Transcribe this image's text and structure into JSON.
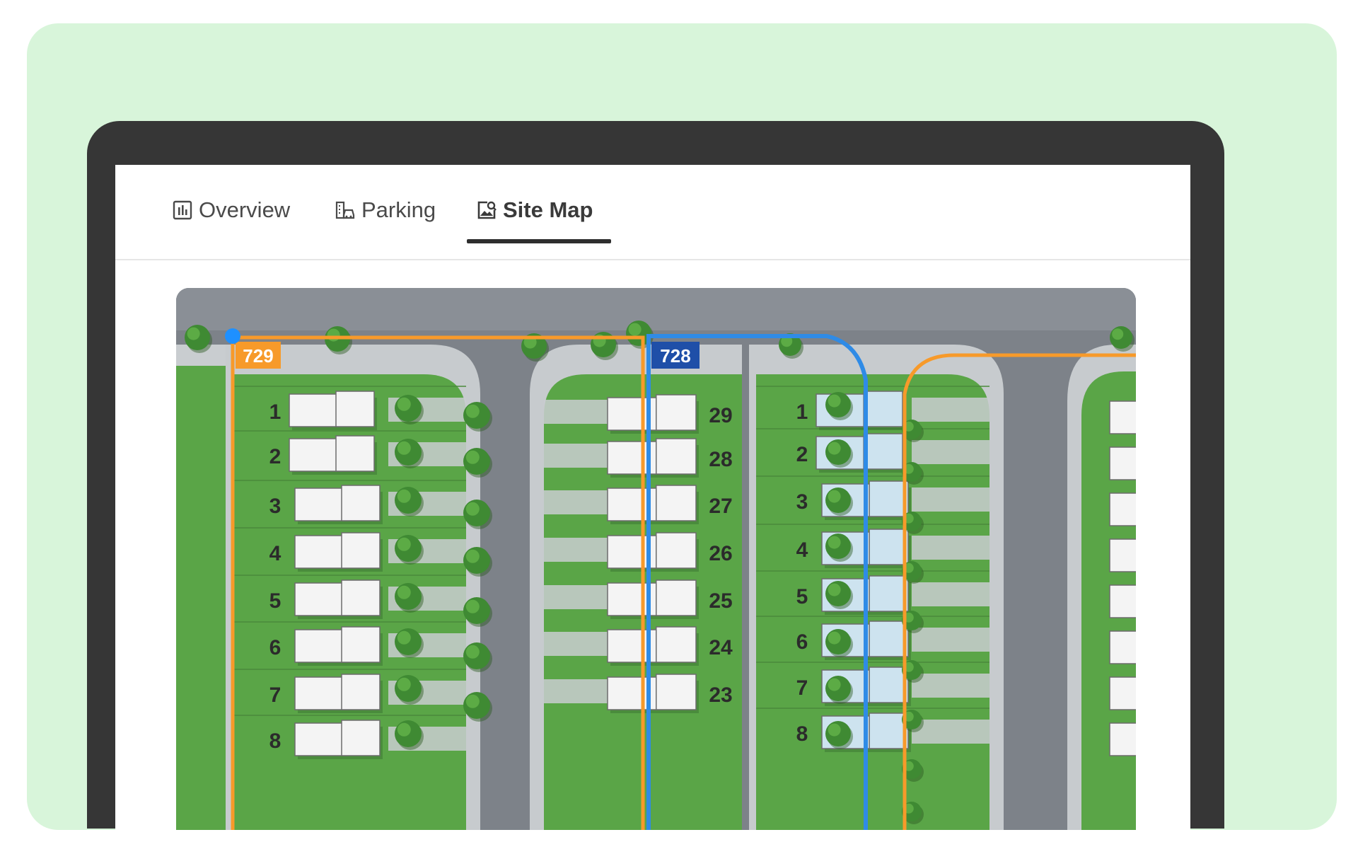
{
  "tabs": [
    {
      "label": "Overview",
      "icon": "bar-chart-icon",
      "active": false
    },
    {
      "label": "Parking",
      "icon": "parking-building-icon",
      "active": false
    },
    {
      "label": "Site Map",
      "icon": "image-search-icon",
      "active": true
    }
  ],
  "site_map": {
    "blocks": [
      {
        "id": "729",
        "color": "#f79a2a",
        "lots_left": [
          "1",
          "2",
          "3",
          "4",
          "5",
          "6",
          "7",
          "8"
        ],
        "lots_right": [
          "29",
          "28",
          "27",
          "26",
          "25",
          "24",
          "23"
        ]
      },
      {
        "id": "728",
        "color": "#2f8be6",
        "lots": [
          "1",
          "2",
          "3",
          "4",
          "5",
          "6",
          "7",
          "8"
        ]
      }
    ],
    "colors": {
      "road": "#7d8289",
      "grass": "#5aa547",
      "house_white": "#f4f4f4",
      "house_blue": "#cde3ef",
      "badge_orange": "#f79a2a",
      "badge_blue": "#1f4fa8",
      "marker": "#1e90ff"
    }
  }
}
